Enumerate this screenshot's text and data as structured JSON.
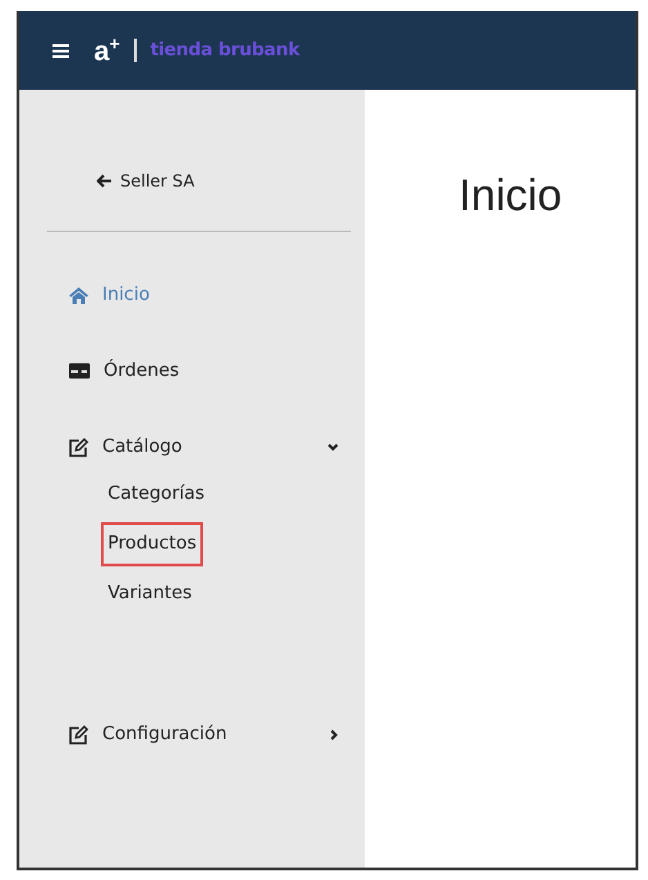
{
  "header": {
    "logo_mark": "a$^{+}$",
    "store_name": "tienda brubank"
  },
  "sidebar": {
    "back_link": "Seller SA",
    "items": [
      {
        "label": "Inicio",
        "kind": "home",
        "selected": true
      },
      {
        "label": "Órdenes",
        "kind": "card",
        "selected": false
      },
      {
        "label": "Catálogo",
        "kind": "edit",
        "selected": false,
        "expanded": true,
        "children": [
          {
            "label": "Categorías",
            "highlighted": false
          },
          {
            "label": "Productos",
            "highlighted": true
          },
          {
            "label": "Variantes",
            "highlighted": false
          }
        ]
      },
      {
        "label": "Configuración",
        "kind": "edit",
        "selected": false,
        "expanded": false
      }
    ]
  },
  "main": {
    "title": "Inicio"
  }
}
